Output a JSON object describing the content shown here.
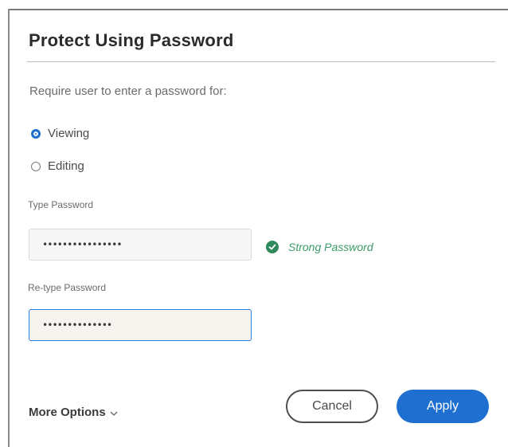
{
  "dialog": {
    "title": "Protect Using Password",
    "instruction": "Require user to enter a password for:",
    "options": [
      {
        "label": "Viewing",
        "selected": true
      },
      {
        "label": "Editing",
        "selected": false
      }
    ],
    "type_password": {
      "label": "Type Password",
      "value": "••••••••••••••••"
    },
    "strength": {
      "icon": "check-circle-icon",
      "text": "Strong Password",
      "color": "#2e8a5a"
    },
    "retype_password": {
      "label": "Re-type Password",
      "value": "••••••••••••••"
    },
    "more_options": "More Options",
    "buttons": {
      "cancel": "Cancel",
      "apply": "Apply"
    },
    "colors": {
      "accent": "#1f6fd1"
    }
  }
}
